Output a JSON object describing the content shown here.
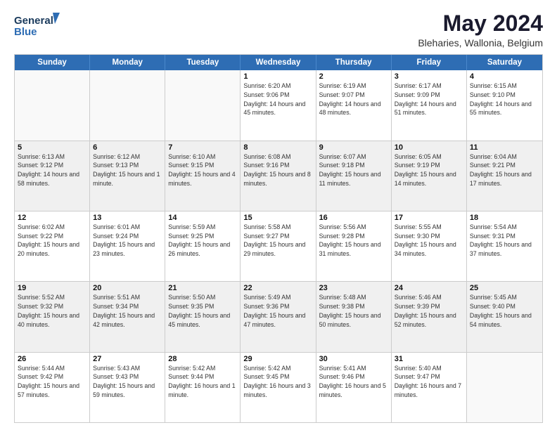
{
  "logo": {
    "line1": "General",
    "line2": "Blue"
  },
  "title": "May 2024",
  "subtitle": "Bleharies, Wallonia, Belgium",
  "days": [
    "Sunday",
    "Monday",
    "Tuesday",
    "Wednesday",
    "Thursday",
    "Friday",
    "Saturday"
  ],
  "weeks": [
    [
      {
        "day": "",
        "empty": true
      },
      {
        "day": "",
        "empty": true
      },
      {
        "day": "",
        "empty": true
      },
      {
        "day": "1",
        "rise": "6:20 AM",
        "set": "9:06 PM",
        "daylight": "14 hours and 45 minutes."
      },
      {
        "day": "2",
        "rise": "6:19 AM",
        "set": "9:07 PM",
        "daylight": "14 hours and 48 minutes."
      },
      {
        "day": "3",
        "rise": "6:17 AM",
        "set": "9:09 PM",
        "daylight": "14 hours and 51 minutes."
      },
      {
        "day": "4",
        "rise": "6:15 AM",
        "set": "9:10 PM",
        "daylight": "14 hours and 55 minutes."
      }
    ],
    [
      {
        "day": "5",
        "rise": "6:13 AM",
        "set": "9:12 PM",
        "daylight": "14 hours and 58 minutes."
      },
      {
        "day": "6",
        "rise": "6:12 AM",
        "set": "9:13 PM",
        "daylight": "15 hours and 1 minute."
      },
      {
        "day": "7",
        "rise": "6:10 AM",
        "set": "9:15 PM",
        "daylight": "15 hours and 4 minutes."
      },
      {
        "day": "8",
        "rise": "6:08 AM",
        "set": "9:16 PM",
        "daylight": "15 hours and 8 minutes."
      },
      {
        "day": "9",
        "rise": "6:07 AM",
        "set": "9:18 PM",
        "daylight": "15 hours and 11 minutes."
      },
      {
        "day": "10",
        "rise": "6:05 AM",
        "set": "9:19 PM",
        "daylight": "15 hours and 14 minutes."
      },
      {
        "day": "11",
        "rise": "6:04 AM",
        "set": "9:21 PM",
        "daylight": "15 hours and 17 minutes."
      }
    ],
    [
      {
        "day": "12",
        "rise": "6:02 AM",
        "set": "9:22 PM",
        "daylight": "15 hours and 20 minutes."
      },
      {
        "day": "13",
        "rise": "6:01 AM",
        "set": "9:24 PM",
        "daylight": "15 hours and 23 minutes."
      },
      {
        "day": "14",
        "rise": "5:59 AM",
        "set": "9:25 PM",
        "daylight": "15 hours and 26 minutes."
      },
      {
        "day": "15",
        "rise": "5:58 AM",
        "set": "9:27 PM",
        "daylight": "15 hours and 29 minutes."
      },
      {
        "day": "16",
        "rise": "5:56 AM",
        "set": "9:28 PM",
        "daylight": "15 hours and 31 minutes."
      },
      {
        "day": "17",
        "rise": "5:55 AM",
        "set": "9:30 PM",
        "daylight": "15 hours and 34 minutes."
      },
      {
        "day": "18",
        "rise": "5:54 AM",
        "set": "9:31 PM",
        "daylight": "15 hours and 37 minutes."
      }
    ],
    [
      {
        "day": "19",
        "rise": "5:52 AM",
        "set": "9:32 PM",
        "daylight": "15 hours and 40 minutes."
      },
      {
        "day": "20",
        "rise": "5:51 AM",
        "set": "9:34 PM",
        "daylight": "15 hours and 42 minutes."
      },
      {
        "day": "21",
        "rise": "5:50 AM",
        "set": "9:35 PM",
        "daylight": "15 hours and 45 minutes."
      },
      {
        "day": "22",
        "rise": "5:49 AM",
        "set": "9:36 PM",
        "daylight": "15 hours and 47 minutes."
      },
      {
        "day": "23",
        "rise": "5:48 AM",
        "set": "9:38 PM",
        "daylight": "15 hours and 50 minutes."
      },
      {
        "day": "24",
        "rise": "5:46 AM",
        "set": "9:39 PM",
        "daylight": "15 hours and 52 minutes."
      },
      {
        "day": "25",
        "rise": "5:45 AM",
        "set": "9:40 PM",
        "daylight": "15 hours and 54 minutes."
      }
    ],
    [
      {
        "day": "26",
        "rise": "5:44 AM",
        "set": "9:42 PM",
        "daylight": "15 hours and 57 minutes."
      },
      {
        "day": "27",
        "rise": "5:43 AM",
        "set": "9:43 PM",
        "daylight": "15 hours and 59 minutes."
      },
      {
        "day": "28",
        "rise": "5:42 AM",
        "set": "9:44 PM",
        "daylight": "16 hours and 1 minute."
      },
      {
        "day": "29",
        "rise": "5:42 AM",
        "set": "9:45 PM",
        "daylight": "16 hours and 3 minutes."
      },
      {
        "day": "30",
        "rise": "5:41 AM",
        "set": "9:46 PM",
        "daylight": "16 hours and 5 minutes."
      },
      {
        "day": "31",
        "rise": "5:40 AM",
        "set": "9:47 PM",
        "daylight": "16 hours and 7 minutes."
      },
      {
        "day": "",
        "empty": true
      }
    ]
  ]
}
